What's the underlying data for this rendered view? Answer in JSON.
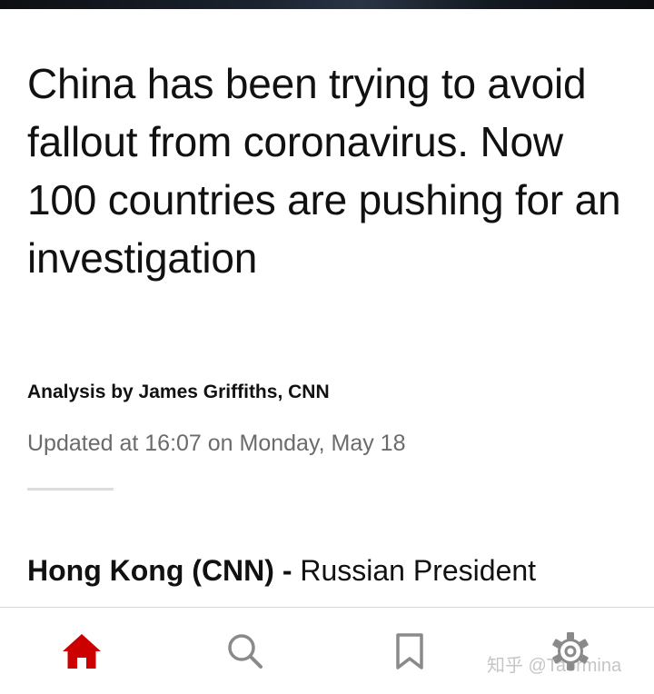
{
  "article": {
    "headline": "China has been trying to avoid fallout from coronavirus. Now 100 countries are pushing for an investigation",
    "byline": "Analysis by James Griffiths, CNN",
    "updated": "Updated at 16:07 on Monday, May 18",
    "lead_dateline": "Hong Kong  (CNN) - ",
    "lead_text": "Russian President"
  },
  "nav": {
    "items": [
      {
        "id": "home",
        "icon": "home-icon",
        "active": true
      },
      {
        "id": "search",
        "icon": "search-icon",
        "active": false
      },
      {
        "id": "bookmarks",
        "icon": "bookmark-icon",
        "active": false
      },
      {
        "id": "settings",
        "icon": "gear-icon",
        "active": false
      }
    ]
  },
  "watermark": "知乎 @Taormina",
  "colors": {
    "accent": "#cc0000",
    "icon_inactive": "#8a8a8a",
    "meta_text": "#6b6b6b"
  }
}
